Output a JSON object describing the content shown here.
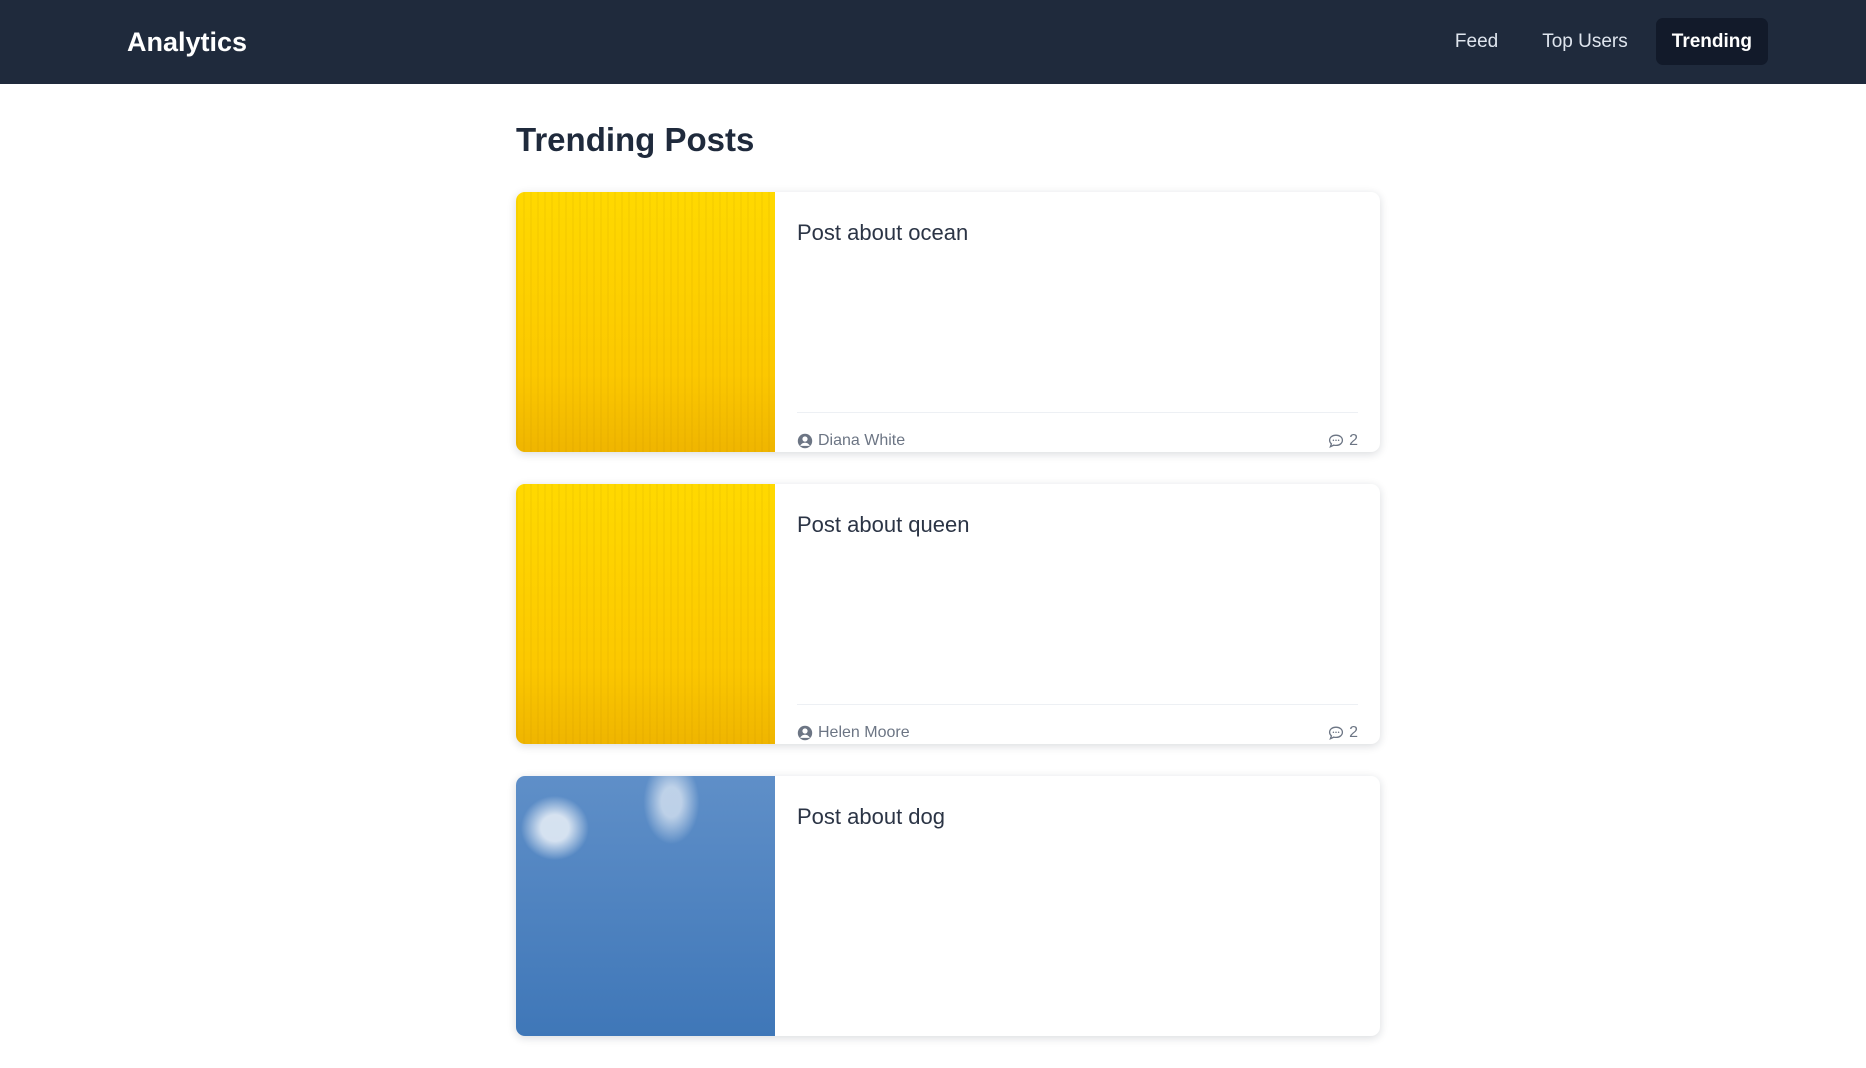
{
  "header": {
    "brand": "Analytics",
    "nav": [
      {
        "label": "Feed"
      },
      {
        "label": "Top Users"
      },
      {
        "label": "Trending"
      }
    ]
  },
  "page": {
    "title": "Trending Posts"
  },
  "posts": [
    {
      "title": "Post about ocean",
      "author": "Diana White",
      "comments": "2",
      "image": "yellow texture"
    },
    {
      "title": "Post about queen",
      "author": "Helen Moore",
      "comments": "2",
      "image": "yellow texture"
    },
    {
      "title": "Post about dog",
      "author": "",
      "comments": "",
      "image": "sky with clouds"
    }
  ],
  "icons": {
    "author": "user-circle-icon",
    "comments": "comment-icon"
  },
  "colors": {
    "header_bg": "#1f2a3c",
    "active_nav_bg": "#121a2a",
    "text_dark": "#1f2a3c",
    "meta_text": "#6c7584",
    "image_yellow": "#ffd200"
  }
}
